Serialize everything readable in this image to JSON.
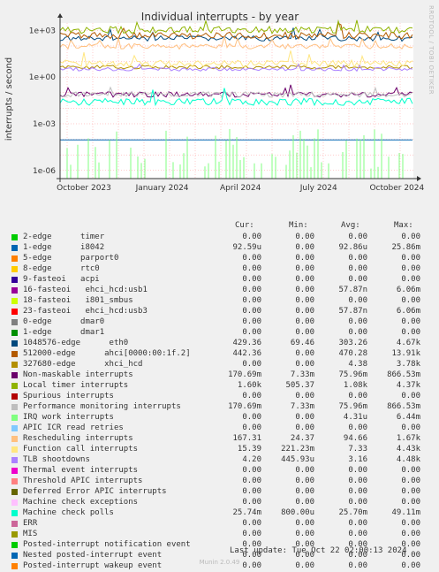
{
  "chart_data": {
    "type": "line",
    "title": "Individual interrupts - by year",
    "ylabel": "interrupts / second",
    "yscale": "log",
    "ylim": [
      3e-07,
      3000
    ],
    "y_ticks": [
      {
        "v": 1000,
        "label": "1e+03"
      },
      {
        "v": 1,
        "label": "1e+00"
      },
      {
        "v": 0.001,
        "label": "1e-03"
      },
      {
        "v": 1e-06,
        "label": "1e-06"
      }
    ],
    "x_ticks": [
      "October 2023",
      "January 2024",
      "April 2024",
      "July 2024",
      "October 2024"
    ],
    "series": [
      {
        "name": "timer",
        "color": "#00cc00",
        "cur": "0.00",
        "min": "0.00",
        "avg": "0.00",
        "max": "0.00",
        "level": null
      },
      {
        "name": "i8042",
        "color": "#0066b3",
        "cur": "92.59u",
        "min": "0.00",
        "avg": "92.86u",
        "max": "25.86m",
        "level": 9.28e-05
      },
      {
        "name": "parport0",
        "color": "#ff8000",
        "cur": "0.00",
        "min": "0.00",
        "avg": "0.00",
        "max": "0.00",
        "level": null
      },
      {
        "name": "rtc0",
        "color": "#ffcc00",
        "cur": "0.00",
        "min": "0.00",
        "avg": "0.00",
        "max": "0.00",
        "level": null
      },
      {
        "name": "acpi",
        "color": "#330099",
        "cur": "0.00",
        "min": "0.00",
        "avg": "0.00",
        "max": "0.00",
        "level": null
      },
      {
        "name": "ehci_hcd:usb1",
        "color": "#990099",
        "cur": "0.00",
        "min": "0.00",
        "avg": "57.87n",
        "max": "6.06m",
        "level": null
      },
      {
        "name": "i801_smbus",
        "color": "#ccff00",
        "cur": "0.00",
        "min": "0.00",
        "avg": "0.00",
        "max": "0.00",
        "level": null
      },
      {
        "name": "ehci_hcd:usb3",
        "color": "#ff0000",
        "cur": "0.00",
        "min": "0.00",
        "avg": "57.87n",
        "max": "6.06m",
        "level": null
      },
      {
        "name": "dmar0",
        "color": "#808080",
        "cur": "0.00",
        "min": "0.00",
        "avg": "0.00",
        "max": "0.00",
        "level": null
      },
      {
        "name": "dmar1",
        "color": "#008f00",
        "cur": "0.00",
        "min": "0.00",
        "avg": "0.00",
        "max": "0.00",
        "level": null
      },
      {
        "name": "eth0",
        "color": "#00487d",
        "cur": "429.36",
        "min": "69.46",
        "avg": "303.26",
        "max": "4.67k",
        "level": 303
      },
      {
        "name": "ahci[0000:00:1f.2]",
        "color": "#b35a00",
        "cur": "442.36",
        "min": "0.00",
        "avg": "470.28",
        "max": "13.91k",
        "level": 470
      },
      {
        "name": "xhci_hcd",
        "color": "#b38f00",
        "cur": "0.00",
        "min": "0.00",
        "avg": "4.38",
        "max": "3.78k",
        "level": 4.4
      },
      {
        "name": "Non-maskable interrupts",
        "color": "#6b006b",
        "cur": "170.69m",
        "min": "7.33m",
        "avg": "75.96m",
        "max": "866.53m",
        "level": 0.076
      },
      {
        "name": "Local timer interrupts",
        "color": "#8fb300",
        "cur": "1.60k",
        "min": "505.37",
        "avg": "1.08k",
        "max": "4.37k",
        "level": 1080
      },
      {
        "name": "Spurious interrupts",
        "color": "#b30000",
        "cur": "0.00",
        "min": "0.00",
        "avg": "0.00",
        "max": "0.00",
        "level": null
      },
      {
        "name": "Performance monitoring interrupts",
        "color": "#bebebe",
        "cur": "170.69m",
        "min": "7.33m",
        "avg": "75.96m",
        "max": "866.53m",
        "level": 0.076
      },
      {
        "name": "IRQ work interrupts",
        "color": "#80ff80",
        "cur": "0.00",
        "min": "0.00",
        "avg": "4.31u",
        "max": "6.44m",
        "level": null
      },
      {
        "name": "APIC ICR read retries",
        "color": "#80c9ff",
        "cur": "0.00",
        "min": "0.00",
        "avg": "0.00",
        "max": "0.00",
        "level": null
      },
      {
        "name": "Rescheduling interrupts",
        "color": "#ffc080",
        "cur": "167.31",
        "min": "24.37",
        "avg": "94.66",
        "max": "1.67k",
        "level": 94.7
      },
      {
        "name": "Function call interrupts",
        "color": "#ffe680",
        "cur": "15.39",
        "min": "221.23m",
        "avg": "7.33",
        "max": "4.43k",
        "level": 7.3
      },
      {
        "name": "TLB shootdowns",
        "color": "#aa80ff",
        "cur": "4.20",
        "min": "445.93u",
        "avg": "3.16",
        "max": "4.48k",
        "level": 3.16
      },
      {
        "name": "Thermal event interrupts",
        "color": "#ee00cc",
        "cur": "0.00",
        "min": "0.00",
        "avg": "0.00",
        "max": "0.00",
        "level": null
      },
      {
        "name": "Threshold APIC interrupts",
        "color": "#ff8080",
        "cur": "0.00",
        "min": "0.00",
        "avg": "0.00",
        "max": "0.00",
        "level": null
      },
      {
        "name": "Deferred Error APIC interrupts",
        "color": "#666600",
        "cur": "0.00",
        "min": "0.00",
        "avg": "0.00",
        "max": "0.00",
        "level": null
      },
      {
        "name": "Machine check exceptions",
        "color": "#ffbfff",
        "cur": "0.00",
        "min": "0.00",
        "avg": "0.00",
        "max": "0.00",
        "level": null
      },
      {
        "name": "Machine check polls",
        "color": "#00ffcc",
        "cur": "25.74m",
        "min": "800.00u",
        "avg": "25.70m",
        "max": "49.11m",
        "level": 0.0257
      },
      {
        "name": "ERR",
        "color": "#cc6699",
        "cur": "0.00",
        "min": "0.00",
        "avg": "0.00",
        "max": "0.00",
        "level": null
      },
      {
        "name": "MIS",
        "color": "#999900",
        "cur": "0.00",
        "min": "0.00",
        "avg": "0.00",
        "max": "0.00",
        "level": null
      },
      {
        "name": "Posted-interrupt notification event",
        "color": "#00cc00",
        "cur": "0.00",
        "min": "0.00",
        "avg": "0.00",
        "max": "0.00",
        "level": null
      },
      {
        "name": "Nested posted-interrupt event",
        "color": "#0066b3",
        "cur": "0.00",
        "min": "0.00",
        "avg": "0.00",
        "max": "0.00",
        "level": null
      },
      {
        "name": "Posted-interrupt wakeup event",
        "color": "#ff8000",
        "cur": "0.00",
        "min": "0.00",
        "avg": "0.00",
        "max": "0.00",
        "level": null
      }
    ]
  },
  "legend_rows": [
    {
      "label": "2-edge      timer"
    },
    {
      "label": "1-edge      i8042"
    },
    {
      "label": "5-edge      parport0"
    },
    {
      "label": "8-edge      rtc0"
    },
    {
      "label": "9-fasteoi   acpi"
    },
    {
      "label": "16-fasteoi   ehci_hcd:usb1"
    },
    {
      "label": "18-fasteoi   i801_smbus"
    },
    {
      "label": "23-fasteoi   ehci_hcd:usb3"
    },
    {
      "label": "0-edge      dmar0"
    },
    {
      "label": "1-edge      dmar1"
    },
    {
      "label": "1048576-edge      eth0"
    },
    {
      "label": "512000-edge      ahci[0000:00:1f.2]"
    },
    {
      "label": "327680-edge      xhci_hcd"
    },
    {
      "label": "Non-maskable interrupts"
    },
    {
      "label": "Local timer interrupts"
    },
    {
      "label": "Spurious interrupts"
    },
    {
      "label": "Performance monitoring interrupts"
    },
    {
      "label": "IRQ work interrupts"
    },
    {
      "label": "APIC ICR read retries"
    },
    {
      "label": "Rescheduling interrupts"
    },
    {
      "label": "Function call interrupts"
    },
    {
      "label": "TLB shootdowns"
    },
    {
      "label": "Thermal event interrupts"
    },
    {
      "label": "Threshold APIC interrupts"
    },
    {
      "label": "Deferred Error APIC interrupts"
    },
    {
      "label": "Machine check exceptions"
    },
    {
      "label": "Machine check polls"
    },
    {
      "label": "ERR"
    },
    {
      "label": "MIS"
    },
    {
      "label": "Posted-interrupt notification event"
    },
    {
      "label": "Nested posted-interrupt event"
    },
    {
      "label": "Posted-interrupt wakeup event"
    }
  ],
  "table_headers": {
    "cur": "Cur:",
    "min": "Min:",
    "avg": "Avg:",
    "max": "Max:"
  },
  "last_update": "Last update: Tue Oct 22 02:00:13 2024",
  "munin_version": "Munin 2.0.49",
  "watermark": "RRDTOOL / TOBI OETIKER"
}
